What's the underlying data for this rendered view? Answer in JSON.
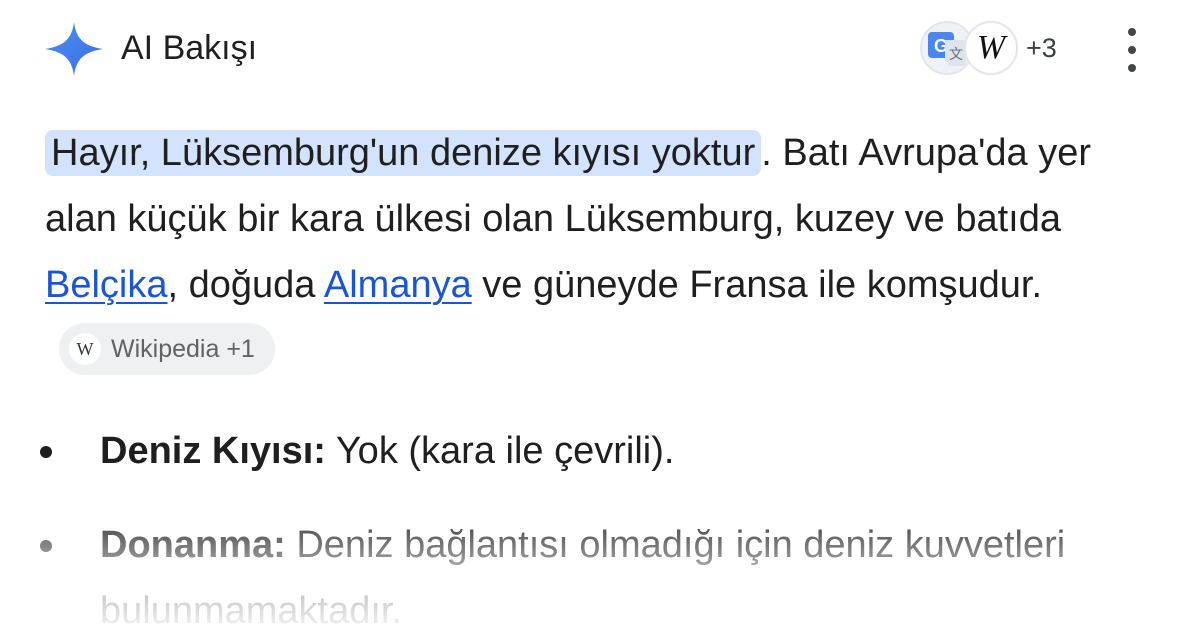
{
  "header": {
    "title": "AI Bakışı",
    "sources_extra": "+3",
    "source_icons": [
      "google-translate-icon",
      "wikipedia-icon"
    ],
    "menu_icon": "more-vert-icon"
  },
  "answer": {
    "highlight": "Hayır, Lüksemburg'un denize kıyısı yoktur",
    "text1": ". Batı Avrupa'da yer alan küçük bir kara ülkesi olan Lüksemburg, kuzey ve batıda ",
    "link1": "Belçika",
    "text2": ", doğuda ",
    "link2": "Almanya",
    "text3": " ve güneyde Fransa ile komşudur.",
    "chip_label": "Wikipedia +1",
    "chip_icon_letter": "W"
  },
  "bullets": [
    {
      "label": "Deniz Kıyısı:",
      "text": " Yok (kara ile çevrili)."
    },
    {
      "label": "Donanma:",
      "text": " Deniz bağlantısı olmadığı için deniz kuvvetleri bulunmamaktadır."
    }
  ],
  "colors": {
    "accent": "#4285f4",
    "highlight": "#d3e3fd",
    "link": "#1a55d9"
  }
}
